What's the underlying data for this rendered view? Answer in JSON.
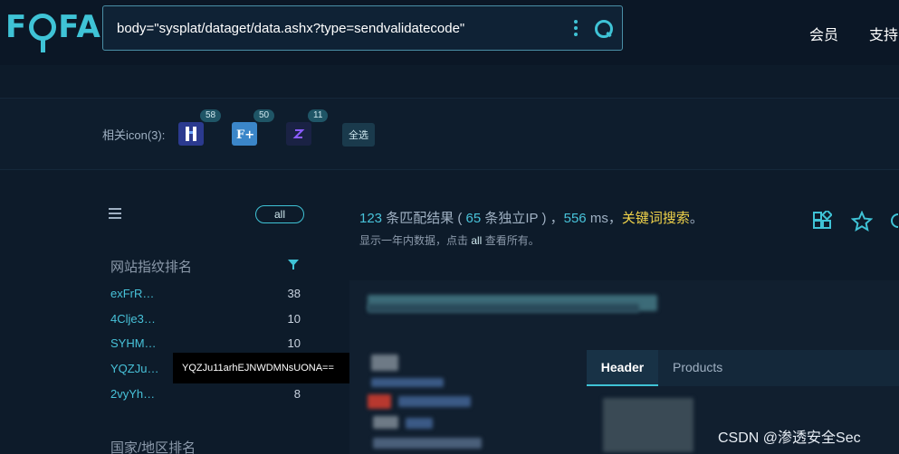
{
  "header": {
    "logo": {
      "part1": "F",
      "part2": "FA"
    },
    "search_query": "body=\"sysplat/dataget/data.ashx?type=sendvalidatecode\"",
    "nav": [
      "会员",
      "支持"
    ]
  },
  "icons_row": {
    "label": "相关icon(3):",
    "icons": [
      {
        "count": "58",
        "color": "#2b3a8f"
      },
      {
        "count": "50",
        "color": "#3b86c9"
      },
      {
        "count": "11",
        "color": "#2c2f66"
      }
    ],
    "select_all": "全选"
  },
  "filter": {
    "all_label": "all"
  },
  "rank": {
    "title": "网站指纹排名",
    "items": [
      {
        "name": "exFrR…",
        "count": "38"
      },
      {
        "name": "4Clje3…",
        "count": "10"
      },
      {
        "name": "SYHM…",
        "count": "10"
      },
      {
        "name": "YQZJu…",
        "count": ""
      },
      {
        "name": "2vyYh…",
        "count": "8"
      }
    ],
    "tooltip": "YQZJu11arhEJNWDMNsUONA=="
  },
  "country_title": "国家/地区排名",
  "results": {
    "count": "123",
    "count_suffix": " 条匹配结果 ( ",
    "ip_count": "65",
    "ip_suffix": " 条独立IP ) ，",
    "ms": "556",
    "ms_suffix": " ms，",
    "keyword_link": "关键词搜索",
    "keyword_end": "。",
    "sub_prefix": "显示一年内数据，点击 ",
    "sub_link": "all",
    "sub_suffix": " 查看所有。"
  },
  "tabs": [
    {
      "label": "Header",
      "active": true
    },
    {
      "label": "Products",
      "active": false
    }
  ],
  "watermark": "CSDN @渗透安全Sec",
  "colors": {
    "accent": "#3fc3d6",
    "keyword": "#f0d34a",
    "background": "#0d1b2a"
  }
}
